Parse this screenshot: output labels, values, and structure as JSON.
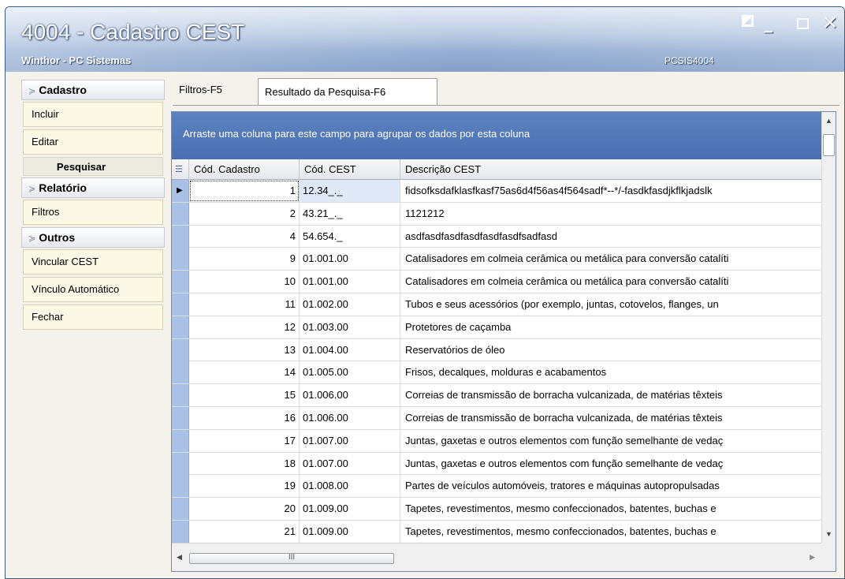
{
  "window": {
    "title": "4004 - Cadastro CEST",
    "subtitle": "Winthor - PC Sistemas",
    "code": "PCSIS4004",
    "controls": {
      "close": "✕",
      "minimize": "_"
    }
  },
  "sidebar": {
    "sections": {
      "cadastro": {
        "title": "Cadastro",
        "chev": "≽"
      },
      "relatorio": {
        "title": "Relatório",
        "chev": "≽"
      },
      "outros": {
        "title": "Outros",
        "chev": "≽"
      }
    },
    "items": {
      "incluir": "Incluir",
      "editar": "Editar",
      "pesquisar": "Pesquisar",
      "filtros": "Filtros",
      "vincular_cest": "Vincular CEST",
      "vinculo_automatico": "Vínculo Automático",
      "fechar": "Fechar"
    }
  },
  "tabs": {
    "filtros": "Filtros-F5",
    "resultado": "Resultado da Pesquisa-F6"
  },
  "grid": {
    "group_hint": "Arraste uma coluna para este campo para agrupar os dados por esta coluna",
    "columns": [
      "Cód. Cadastro",
      "Cód. CEST",
      "Descrição CEST"
    ],
    "rows": [
      [
        "1",
        "12.34_._",
        "fidsofksdafklasfkasf75as6d4f56as4f564sadf*--*/-fasdkfasdjkflkjadslk"
      ],
      [
        "2",
        "43.21_._",
        "1121212"
      ],
      [
        "4",
        "54.654._",
        "asdfasdfasdfasdfasdfasdfsadfasd"
      ],
      [
        "9",
        "01.001.00",
        "Catalisadores em colmeia cerâmica ou metálica para conversão catalíti"
      ],
      [
        "10",
        "01.001.00",
        "Catalisadores em colmeia cerâmica ou metálica para conversão catalíti"
      ],
      [
        "11",
        "01.002.00",
        "Tubos e seus acessórios (por exemplo, juntas, cotovelos, flanges, un"
      ],
      [
        "12",
        "01.003.00",
        "Protetores de caçamba"
      ],
      [
        "13",
        "01.004.00",
        "Reservatórios de óleo"
      ],
      [
        "14",
        "01.005.00",
        "Frisos, decalques, molduras e acabamentos"
      ],
      [
        "15",
        "01.006.00",
        "Correias de transmissão de borracha vulcanizada, de matérias têxteis"
      ],
      [
        "16",
        "01.006.00",
        "Correias de transmissão de borracha vulcanizada, de matérias têxteis"
      ],
      [
        "17",
        "01.007.00",
        "Juntas, gaxetas e outros elementos com função semelhante de vedaç"
      ],
      [
        "18",
        "01.007.00",
        "Juntas, gaxetas e outros elementos com função semelhante de vedaç"
      ],
      [
        "19",
        "01.008.00",
        "Partes de veículos automóveis, tratores e máquinas autopropulsadas"
      ],
      [
        "20",
        "01.009.00",
        "Tapetes, revestimentos, mesmo confeccionados, batentes, buchas e"
      ],
      [
        "21",
        "01.009.00",
        "Tapetes, revestimentos, mesmo confeccionados, batentes, buchas e"
      ]
    ],
    "selected_row_index": 0,
    "hscroll_grip": "III"
  },
  "colors": {
    "group_panel": "#4a70b3",
    "row_indicator": "#a9c1e4",
    "sidebar_item_bg": "#fbf8e5"
  }
}
